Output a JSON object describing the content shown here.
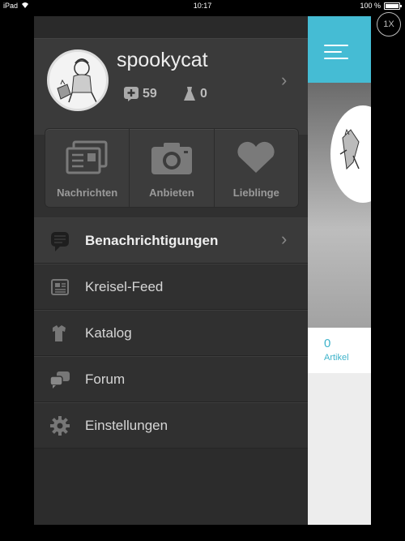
{
  "status_bar": {
    "device": "iPad",
    "time": "10:17",
    "battery": "100 %"
  },
  "zoom_button": {
    "label": "1X"
  },
  "profile": {
    "username": "spookycat",
    "points": "59",
    "items": "0"
  },
  "actions": [
    {
      "label": "Nachrichten",
      "icon": "inbox-icon"
    },
    {
      "label": "Anbieten",
      "icon": "camera-icon"
    },
    {
      "label": "Lieblinge",
      "icon": "heart-icon"
    }
  ],
  "menu": [
    {
      "label": "Benachrichtigungen",
      "icon": "speech-bubble-icon",
      "active": true
    },
    {
      "label": "Kreisel-Feed",
      "icon": "newspaper-icon"
    },
    {
      "label": "Katalog",
      "icon": "clothing-icon"
    },
    {
      "label": "Forum",
      "icon": "chat-bubbles-icon"
    },
    {
      "label": "Einstellungen",
      "icon": "gear-icon"
    }
  ],
  "peek": {
    "items_count": "0",
    "items_label": "Artikel"
  },
  "colors": {
    "accent": "#45bcd4",
    "drawer": "#303030"
  }
}
